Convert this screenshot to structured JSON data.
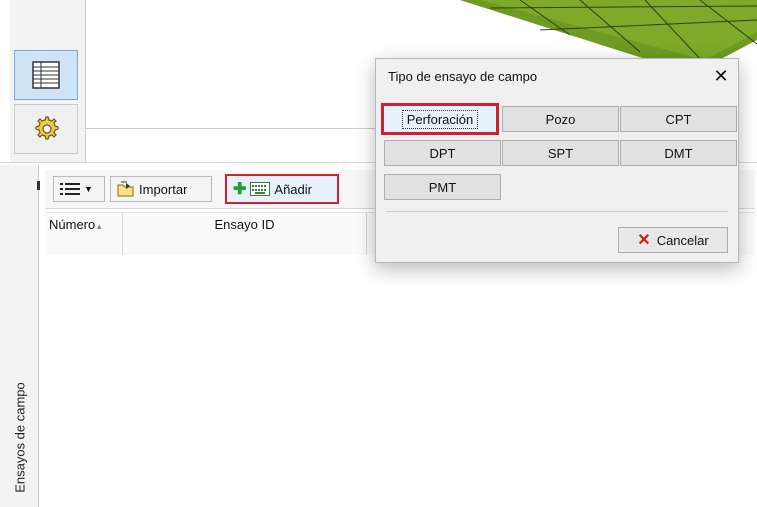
{
  "side_tab": {
    "label": "Ensayos de campo"
  },
  "toolbar": {
    "import_label": "Importar",
    "add_label": "Añadir"
  },
  "table": {
    "columns": [
      {
        "label": "Número"
      },
      {
        "label": "Ensayo ID"
      }
    ],
    "sort_indicator": "▲"
  },
  "dialog": {
    "title": "Tipo de ensayo de campo",
    "close_glyph": "✕",
    "options": [
      "Perforación",
      "Pozo",
      "CPT",
      "DPT",
      "SPT",
      "DMT",
      "PMT"
    ],
    "cancel_label": "Cancelar",
    "cancel_icon": "✕"
  },
  "icons": {
    "grid_view": "grid-icon",
    "settings": "gear-icon",
    "list_menu": "list-icon",
    "import": "folder-arrow-icon",
    "add": "plus-keyboard-icon"
  },
  "colors": {
    "highlight_red": "#d11f2f",
    "active_blue": "#cfe4f7",
    "grid_green": "#6b8f22",
    "cancel_red": "#d21d1d",
    "add_green": "#1fa12c"
  }
}
